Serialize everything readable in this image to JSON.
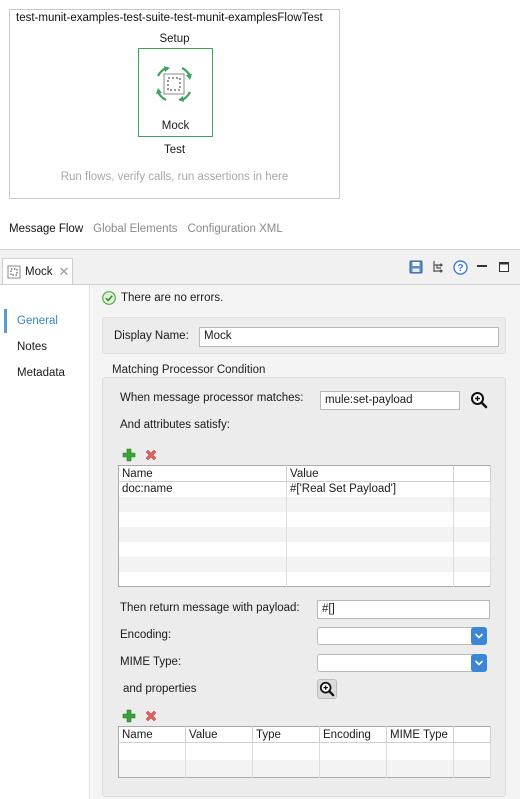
{
  "canvas": {
    "flow_title": "test-munit-examples-test-suite-test-munit-examplesFlowTest",
    "setup_label": "Setup",
    "processor_label": "Mock",
    "test_label": "Test",
    "hint": "Run flows, verify calls, run assertions in here"
  },
  "editor_tabs": [
    "Message Flow",
    "Global Elements",
    "Configuration XML"
  ],
  "properties": {
    "tab_title": "Mock",
    "close_glyph": "✕",
    "toolbar_icons": [
      "save-icon",
      "tree-icon",
      "help-icon",
      "minimize-icon",
      "maximize-icon"
    ],
    "nav": [
      "General",
      "Notes",
      "Metadata"
    ],
    "status": "There are no errors.",
    "display_name_label": "Display Name:",
    "display_name_value": "Mock",
    "matching_group_title": "Matching Processor Condition",
    "when_matches_label": "When message processor matches:",
    "when_matches_value": "mule:set-payload",
    "attributes_label": "And attributes satisfy:",
    "attributes_table": {
      "columns": [
        "Name",
        "Value",
        ""
      ],
      "rows": [
        [
          "doc:name",
          "#['Real Set Payload']",
          ""
        ]
      ]
    },
    "payload_label": "Then return message with payload:",
    "payload_value": "#[]",
    "encoding_label": "Encoding:",
    "encoding_value": "",
    "mime_label": "MIME Type:",
    "mime_value": "",
    "properties_label": "and properties",
    "properties_table": {
      "columns": [
        "Name",
        "Value",
        "Type",
        "Encoding",
        "MIME Type",
        ""
      ],
      "rows": []
    }
  },
  "colors": {
    "accent_blue": "#3b87d6",
    "nav_active": "#3d83c4",
    "mock_border": "#3fa35a",
    "add_green": "#3aa23a",
    "remove_red": "#e06060"
  }
}
